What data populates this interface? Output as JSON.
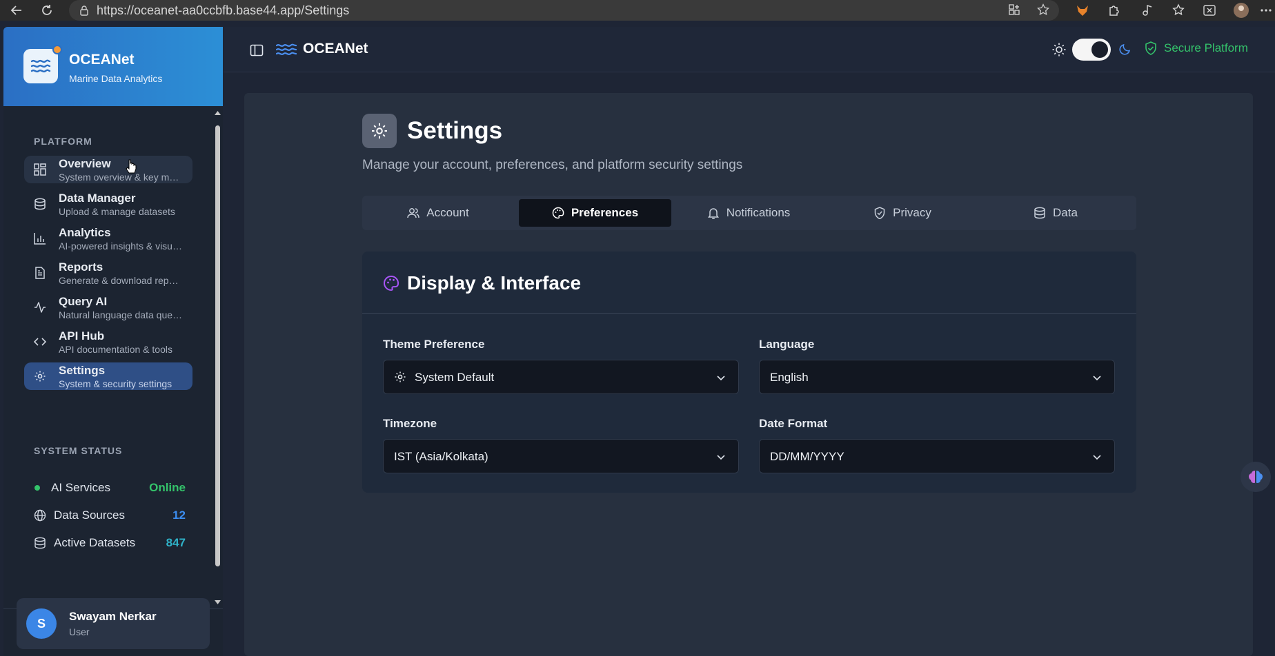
{
  "browser": {
    "url": "https://oceanet-aa0ccbfb.base44.app/Settings"
  },
  "brand": {
    "name": "OCEANet",
    "tagline": "Marine Data Analytics"
  },
  "sidebar": {
    "platform_label": "PLATFORM",
    "items": [
      {
        "label": "Overview",
        "sub": "System overview & key metrics",
        "icon": "grid-icon"
      },
      {
        "label": "Data Manager",
        "sub": "Upload & manage datasets",
        "icon": "database-icon"
      },
      {
        "label": "Analytics",
        "sub": "AI-powered insights & visualizations",
        "icon": "bar-chart-icon"
      },
      {
        "label": "Reports",
        "sub": "Generate & download reports",
        "icon": "file-icon"
      },
      {
        "label": "Query AI",
        "sub": "Natural language data queries",
        "icon": "activity-icon"
      },
      {
        "label": "API Hub",
        "sub": "API documentation & tools",
        "icon": "code-icon"
      },
      {
        "label": "Settings",
        "sub": "System & security settings",
        "icon": "gear-icon"
      }
    ],
    "status_label": "SYSTEM STATUS",
    "status": [
      {
        "label": "AI Services",
        "value": "Online",
        "color": "#34c46b"
      },
      {
        "label": "Data Sources",
        "value": "12",
        "color": "#3b8df0"
      },
      {
        "label": "Active Datasets",
        "value": "847",
        "color": "#2fb3c9"
      }
    ]
  },
  "user": {
    "initial": "S",
    "name": "Swayam Nerkar",
    "role": "User"
  },
  "topbar": {
    "title": "OCEANet",
    "secure_label": "Secure Platform",
    "dark_mode": true
  },
  "page": {
    "title": "Settings",
    "subtitle": "Manage your account, preferences, and platform security settings"
  },
  "tabs": [
    {
      "label": "Account",
      "icon": "users-icon"
    },
    {
      "label": "Preferences",
      "icon": "palette-icon",
      "active": true
    },
    {
      "label": "Notifications",
      "icon": "bell-icon"
    },
    {
      "label": "Privacy",
      "icon": "shield-icon"
    },
    {
      "label": "Data",
      "icon": "database-icon"
    }
  ],
  "display_card": {
    "title": "Display & Interface",
    "theme_label": "Theme Preference",
    "theme_value": "System Default",
    "language_label": "Language",
    "language_value": "English",
    "timezone_label": "Timezone",
    "timezone_value": "IST (Asia/Kolkata)",
    "date_format_label": "Date Format",
    "date_format_value": "DD/MM/YYYY"
  },
  "colors": {
    "accent": "#2f4f86",
    "brand_gradient_start": "#2b6fc4",
    "secure_green": "#34c46b"
  }
}
